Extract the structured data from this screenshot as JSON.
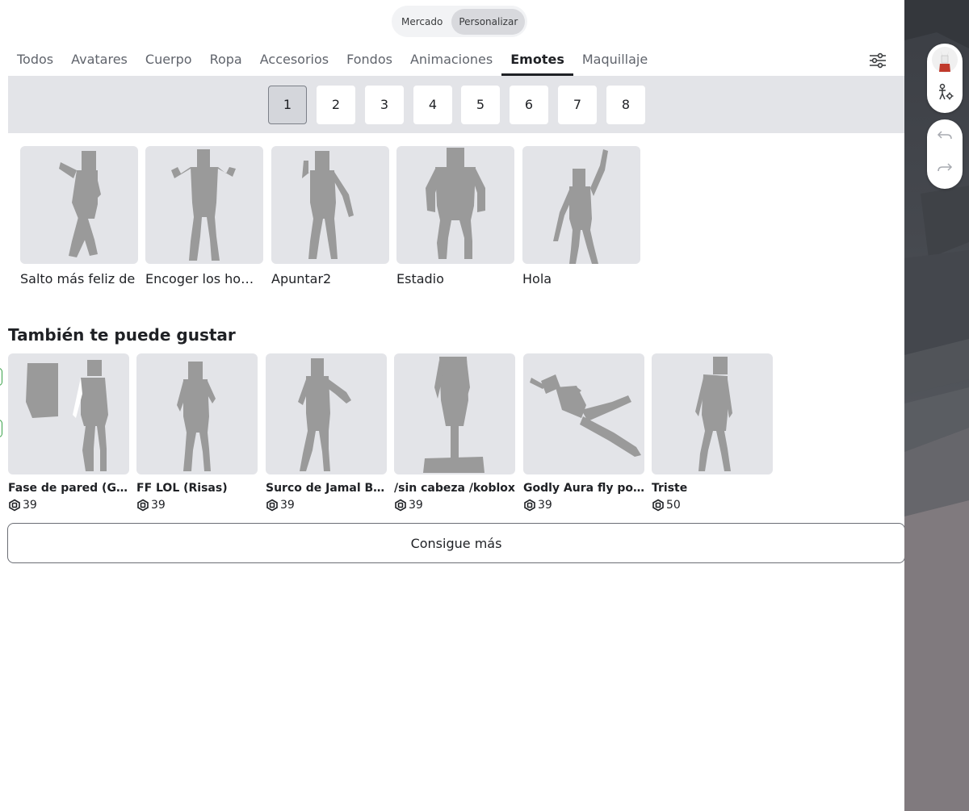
{
  "toggle": {
    "market": "Mercado",
    "customize": "Personalizar"
  },
  "categories": [
    "Todos",
    "Avatares",
    "Cuerpo",
    "Ropa",
    "Accesorios",
    "Fondos",
    "Animaciones",
    "Emotes",
    "Maquillaje"
  ],
  "active_category": "Emotes",
  "pages": [
    "1",
    "2",
    "3",
    "4",
    "5",
    "6",
    "7",
    "8"
  ],
  "active_page": "1",
  "emotes": [
    {
      "name": "Salto más feliz de"
    },
    {
      "name": "Encoger los hombros"
    },
    {
      "name": "Apuntar2"
    },
    {
      "name": "Estadio"
    },
    {
      "name": "Hola"
    }
  ],
  "recommendations": {
    "title": "También te puede gustar",
    "items": [
      {
        "name": "Fase de pared (GLITCH)",
        "price": "39"
      },
      {
        "name": "FF LOL (Risas)",
        "price": "39"
      },
      {
        "name": "Surco de Jamal Brady",
        "price": "39"
      },
      {
        "name": "/sin cabeza /koblox",
        "price": "39"
      },
      {
        "name": "Godly Aura fly pose",
        "price": "39"
      },
      {
        "name": "Triste",
        "price": "50"
      }
    ]
  },
  "more_button": "Consigue más",
  "colors": {
    "accent": "#1f2125",
    "tile": "#e3e4e8",
    "figure": "#9a9a9a",
    "scene": "#46494f"
  },
  "icons": [
    "filter-sliders-icon",
    "robux-icon",
    "avatar-thumbnail-icon",
    "avatar-settings-icon",
    "undo-icon",
    "redo-icon"
  ]
}
